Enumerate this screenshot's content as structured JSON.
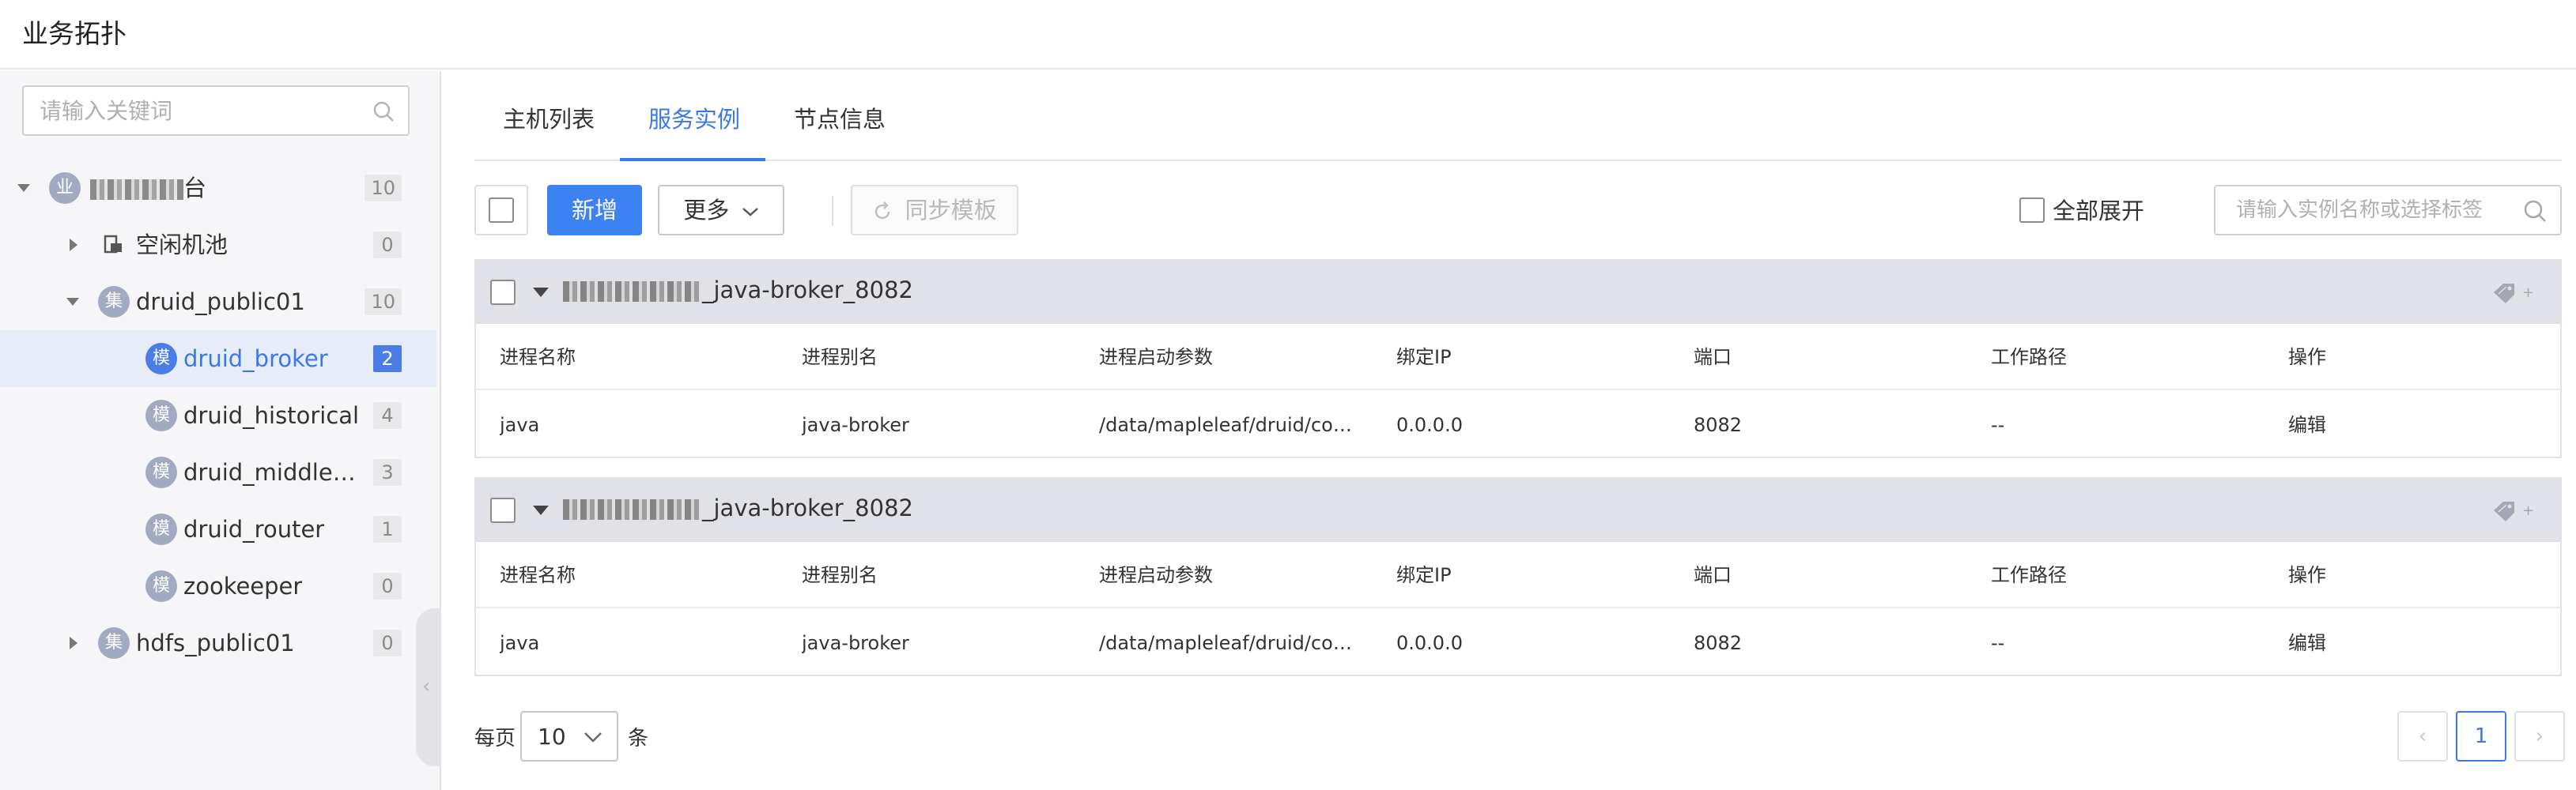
{
  "app": {
    "title": "业务拓扑"
  },
  "sidebar": {
    "search": {
      "placeholder": "请输入关键词"
    },
    "tree": [
      {
        "badge": "业",
        "label": "",
        "count": "10",
        "expanded": true
      },
      {
        "badge": "",
        "label": "空闲机池",
        "count": "0",
        "expanded": false
      },
      {
        "badge": "集",
        "label": "druid_public01",
        "count": "10",
        "expanded": true
      },
      {
        "badge": "模",
        "label": "druid_broker",
        "count": "2",
        "selected": true
      },
      {
        "badge": "模",
        "label": "druid_historical",
        "count": "4"
      },
      {
        "badge": "模",
        "label": "druid_middlemanager",
        "count": "3"
      },
      {
        "badge": "模",
        "label": "druid_router",
        "count": "1"
      },
      {
        "badge": "模",
        "label": "zookeeper",
        "count": "0"
      },
      {
        "badge": "集",
        "label": "hdfs_public01",
        "count": "0",
        "expanded": false
      }
    ],
    "root_suffix": "台"
  },
  "tabs": [
    {
      "label": "主机列表"
    },
    {
      "label": "服务实例",
      "active": true
    },
    {
      "label": "节点信息"
    }
  ],
  "toolbar": {
    "add_label": "新增",
    "more_label": "更多",
    "sync_label": "同步模板",
    "expand_all_label": "全部展开",
    "search_placeholder": "请输入实例名称或选择标签"
  },
  "columns": [
    "进程名称",
    "进程别名",
    "进程启动参数",
    "绑定IP",
    "端口",
    "工作路径",
    "操作"
  ],
  "instances": [
    {
      "name_suffix": "_java-broker_8082",
      "row": [
        "java",
        "java-broker",
        "/data/mapleleaf/druid/con...",
        "0.0.0.0",
        "8082",
        "--",
        "编辑"
      ]
    },
    {
      "name_suffix": "_java-broker_8082",
      "row": [
        "java",
        "java-broker",
        "/data/mapleleaf/druid/con...",
        "0.0.0.0",
        "8082",
        "--",
        "编辑"
      ]
    }
  ],
  "pagination": {
    "per_page_prefix": "每页",
    "per_page_value": "10",
    "per_page_suffix": "条",
    "current_page": "1"
  },
  "colors": {
    "accent": "#3c78e6",
    "primary_button": "#3c82f0",
    "sidebar_bg": "#f6f6f8",
    "card_header_bg": "#e1e2e8"
  }
}
